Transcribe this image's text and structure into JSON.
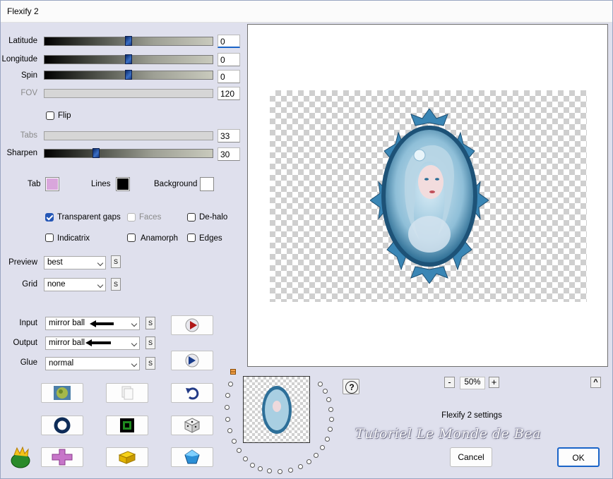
{
  "window": {
    "title": "Flexify 2"
  },
  "sliders": {
    "latitude": {
      "label": "Latitude",
      "value": "0",
      "level": 0.5
    },
    "longitude": {
      "label": "Longitude",
      "value": "0",
      "level": 0.5
    },
    "spin": {
      "label": "Spin",
      "value": "0",
      "level": 0.5
    },
    "fov": {
      "label": "FOV",
      "value": "120"
    },
    "tabs": {
      "label": "Tabs",
      "value": "33"
    },
    "sharpen": {
      "label": "Sharpen",
      "value": "30",
      "level": 0.3
    }
  },
  "flip": {
    "label": "Flip",
    "checked": false
  },
  "colors": {
    "tab": {
      "label": "Tab",
      "color": "#d9a6dc"
    },
    "lines": {
      "label": "Lines",
      "color": "#000000"
    },
    "background": {
      "label": "Background",
      "color": "#ffffff"
    }
  },
  "options": {
    "transparent_gaps": {
      "label": "Transparent gaps",
      "checked": true
    },
    "faces": {
      "label": "Faces",
      "checked": false,
      "disabled": true
    },
    "de_halo": {
      "label": "De-halo",
      "checked": false
    },
    "indicatrix": {
      "label": "Indicatrix",
      "checked": false
    },
    "anamorph": {
      "label": "Anamorph",
      "checked": false
    },
    "edges": {
      "label": "Edges",
      "checked": false
    }
  },
  "preview": {
    "label": "Preview",
    "value": "best",
    "s": "S"
  },
  "grid": {
    "label": "Grid",
    "value": "none",
    "s": "S"
  },
  "input": {
    "label": "Input",
    "value": "mirror ball",
    "s": "S"
  },
  "output": {
    "label": "Output",
    "value": "mirror ball",
    "s": "S"
  },
  "glue": {
    "label": "Glue",
    "value": "normal",
    "s": "S"
  },
  "zoom": {
    "minus": "-",
    "value": "50%",
    "plus": "+"
  },
  "help": "?",
  "collapse": "^",
  "settings_label": "Flexify 2 settings",
  "watermark": "Tutoriel Le Monde de Bea",
  "buttons": {
    "cancel": "Cancel",
    "ok": "OK"
  },
  "accent": "#1a64c8"
}
